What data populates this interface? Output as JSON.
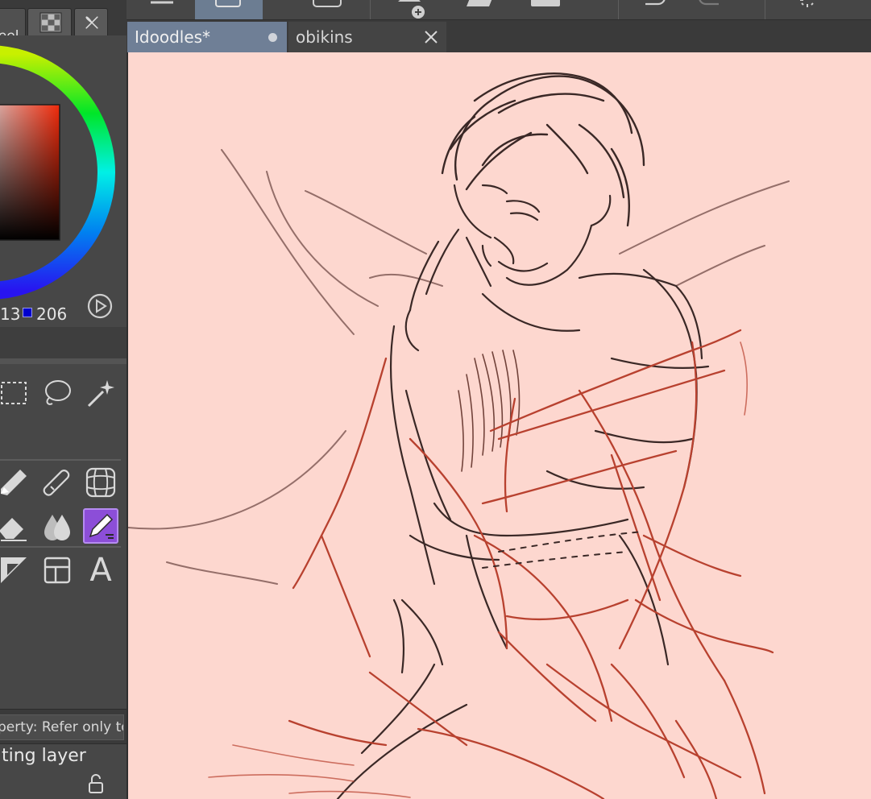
{
  "left_panel": {
    "tab_label": "heel",
    "readout_partial": "13",
    "blue_value": "206",
    "property_text": "perty: Refer only to",
    "reference_label": "ting layer"
  },
  "document_tabs": [
    {
      "label": "Idoodles*",
      "active": true
    },
    {
      "label": "obikins",
      "active": false
    }
  ],
  "colors": {
    "canvas_background": "#fdd7cf",
    "active_tab": "#6f7f96",
    "selected_tool": "#8c4ed8",
    "blue_swatch": "#0000ce"
  },
  "tools": [
    "rect-select-icon",
    "lasso-icon",
    "magic-wand-icon",
    "marker-icon",
    "airbrush-icon",
    "ruler-grid-icon",
    "eraser-icon",
    "blend-icon",
    "pencil-icon",
    "figure-icon",
    "frame-icon",
    "text-icon"
  ],
  "text_tool_glyph": "A"
}
